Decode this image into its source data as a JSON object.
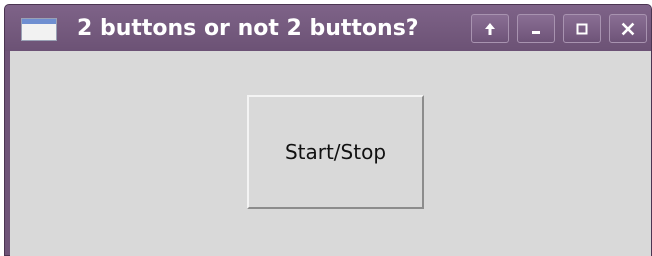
{
  "window": {
    "title": "2 buttons or not 2 buttons?",
    "title_color": "#ffffff",
    "titlebar_color": "#6f5478",
    "client_bg": "#d9d9d9",
    "controls": {
      "up_icon": "arrow-up-icon",
      "minimize_icon": "minimize-icon",
      "maximize_icon": "maximize-icon",
      "close_icon": "close-icon"
    }
  },
  "main": {
    "start_stop_label": "Start/Stop"
  }
}
